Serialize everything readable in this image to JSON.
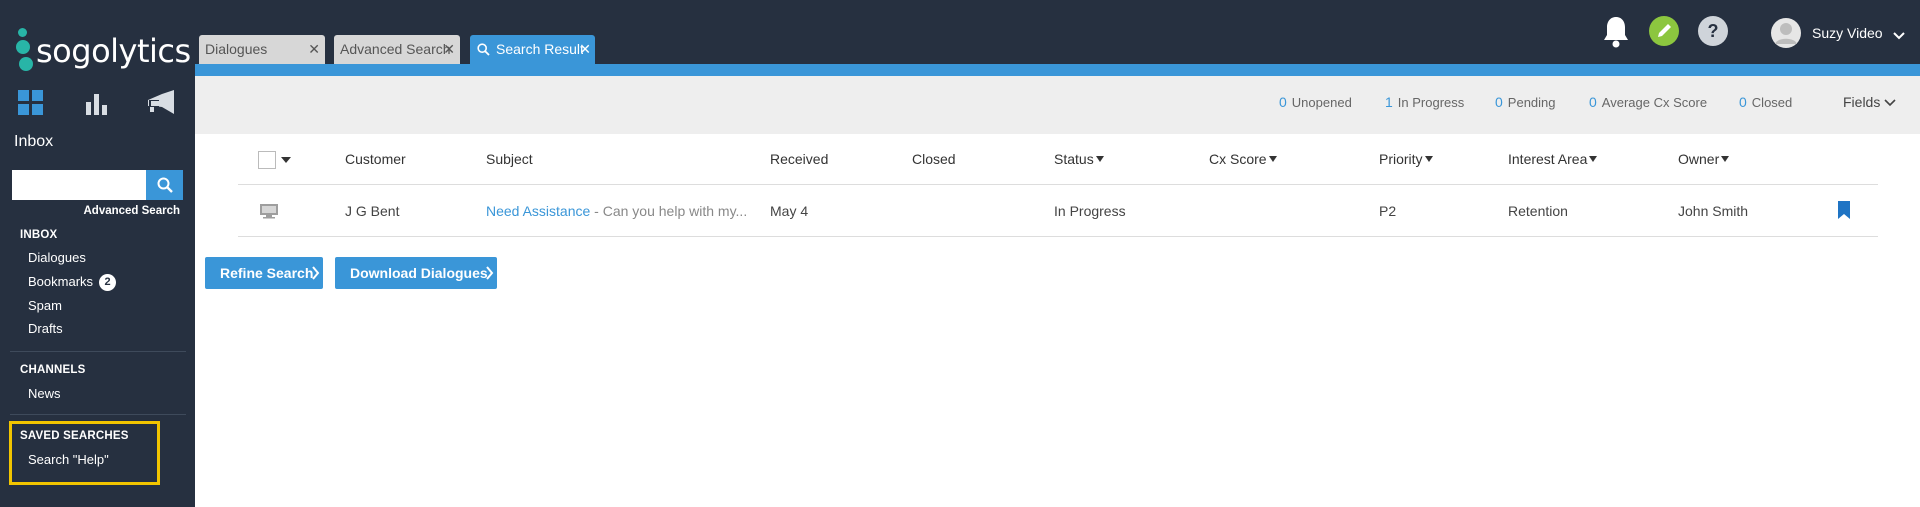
{
  "brand": {
    "name": "sogolytics",
    "accent": "#3a96d8",
    "sidebar_bg": "#263040",
    "logo_dot_color": "#28b5a7"
  },
  "sidebar": {
    "nav_icons": [
      "dashboard-icon",
      "bar-chart-icon",
      "megaphone-icon"
    ],
    "title": "Inbox",
    "search": {
      "placeholder": "",
      "value": ""
    },
    "advanced_search": "Advanced Search",
    "sections": {
      "inbox": {
        "heading": "INBOX",
        "items": [
          {
            "label": "Dialogues"
          },
          {
            "label": "Bookmarks",
            "badge": "2"
          },
          {
            "label": "Spam"
          },
          {
            "label": "Drafts"
          }
        ]
      },
      "channels": {
        "heading": "CHANNELS",
        "items": [
          {
            "label": "News"
          }
        ]
      },
      "saved_searches": {
        "heading": "SAVED SEARCHES",
        "items": [
          {
            "label": "Search \"Help\""
          }
        ],
        "highlight_color": "#f2c500"
      }
    }
  },
  "tabs": [
    {
      "label": "Dialogues",
      "active": false
    },
    {
      "label": "Advanced Search",
      "active": false
    },
    {
      "label": "Search Results",
      "active": true,
      "icon": "search-icon"
    }
  ],
  "header": {
    "icons": [
      "bell-icon",
      "pencil-icon",
      "help-icon"
    ],
    "user": {
      "name": "Suzy Video",
      "avatar": "avatar-icon"
    }
  },
  "stats": [
    {
      "count": "0",
      "label": "Unopened"
    },
    {
      "count": "1",
      "label": "In Progress"
    },
    {
      "count": "0",
      "label": "Pending"
    },
    {
      "count": "0",
      "label": "Average Cx Score"
    },
    {
      "count": "0",
      "label": "Closed"
    }
  ],
  "fields_label": "Fields",
  "table": {
    "columns": [
      "Customer",
      "Subject",
      "Received",
      "Closed",
      "Status",
      "Cx Score",
      "Priority",
      "Interest Area",
      "Owner"
    ],
    "rows": [
      {
        "channel_icon": "monitor-icon",
        "customer": "J G Bent",
        "subject_link": "Need Assistance",
        "subject_snippet": " - Can you help with my...",
        "received": "May 4",
        "closed": "",
        "status": "In Progress",
        "cx_score": "",
        "priority": "P2",
        "interest_area": "Retention",
        "owner": "John Smith",
        "bookmarked": true
      }
    ]
  },
  "buttons": {
    "refine": "Refine Search",
    "download": "Download Dialogues"
  }
}
